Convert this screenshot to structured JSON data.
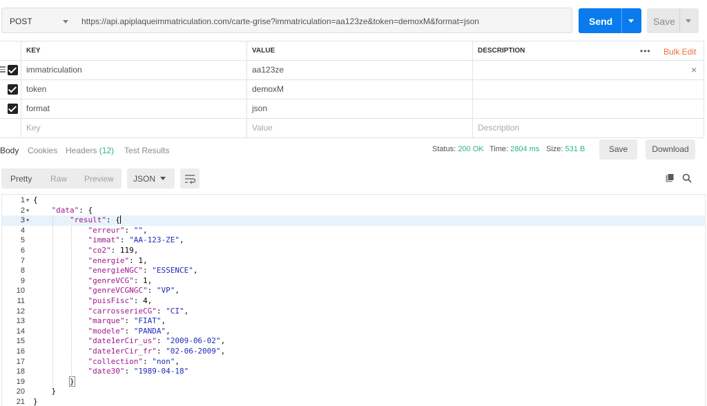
{
  "request": {
    "method": "POST",
    "url": "https://api.apiplaqueimmatriculation.com/carte-grise?immatriculation=aa123ze&token=demoxM&format=json",
    "send_label": "Send",
    "save_label": "Save"
  },
  "params": {
    "headers": {
      "key": "KEY",
      "value": "VALUE",
      "description": "DESCRIPTION",
      "dots": "•••",
      "bulk_edit": "Bulk Edit"
    },
    "rows": [
      {
        "key": "immatriculation",
        "value": "aa123ze",
        "description": "",
        "checked": true
      },
      {
        "key": "token",
        "value": "demoxM",
        "description": "",
        "checked": true
      },
      {
        "key": "format",
        "value": "json",
        "description": "",
        "checked": true
      }
    ],
    "placeholder": {
      "key": "Key",
      "value": "Value",
      "description": "Description"
    },
    "remove_icon": "×"
  },
  "response_tabs": {
    "body": "Body",
    "cookies": "Cookies",
    "headers": "Headers",
    "headers_count": "(12)",
    "test_results": "Test Results"
  },
  "status": {
    "status_label": "Status:",
    "status_value": "200 OK",
    "time_label": "Time:",
    "time_value": "2804 ms",
    "size_label": "Size:",
    "size_value": "531 B",
    "save_label": "Save",
    "download_label": "Download"
  },
  "view": {
    "pretty": "Pretty",
    "raw": "Raw",
    "preview": "Preview",
    "format": "JSON"
  },
  "colors": {
    "send": "#097bed",
    "success": "#26b47f",
    "bulk_edit": "#f26b3a",
    "json_key": "#a0178c",
    "json_string": "#1e2bb8"
  },
  "code_lines": [
    {
      "n": "1",
      "fold": true
    },
    {
      "n": "2",
      "fold": true
    },
    {
      "n": "3",
      "fold": true,
      "highlight": true
    },
    {
      "n": "4"
    },
    {
      "n": "5"
    },
    {
      "n": "6"
    },
    {
      "n": "7"
    },
    {
      "n": "8"
    },
    {
      "n": "9"
    },
    {
      "n": "10"
    },
    {
      "n": "11"
    },
    {
      "n": "12"
    },
    {
      "n": "13"
    },
    {
      "n": "14"
    },
    {
      "n": "15"
    },
    {
      "n": "16"
    },
    {
      "n": "17"
    },
    {
      "n": "18"
    },
    {
      "n": "19"
    },
    {
      "n": "20"
    },
    {
      "n": "21"
    }
  ],
  "json": {
    "open": "{",
    "close": "}",
    "data_key": "\"data\"",
    "result_key": "\"result\"",
    "fields": [
      {
        "key": "\"erreur\"",
        "value": "\"\"",
        "type": "s"
      },
      {
        "key": "\"immat\"",
        "value": "\"AA-123-ZE\"",
        "type": "s"
      },
      {
        "key": "\"co2\"",
        "value": "119",
        "type": "n"
      },
      {
        "key": "\"energie\"",
        "value": "1",
        "type": "n"
      },
      {
        "key": "\"energieNGC\"",
        "value": "\"ESSENCE\"",
        "type": "s"
      },
      {
        "key": "\"genreVCG\"",
        "value": "1",
        "type": "n"
      },
      {
        "key": "\"genreVCGNGC\"",
        "value": "\"VP\"",
        "type": "s"
      },
      {
        "key": "\"puisFisc\"",
        "value": "4",
        "type": "n"
      },
      {
        "key": "\"carrosserieCG\"",
        "value": "\"CI\"",
        "type": "s"
      },
      {
        "key": "\"marque\"",
        "value": "\"FIAT\"",
        "type": "s"
      },
      {
        "key": "\"modele\"",
        "value": "\"PANDA\"",
        "type": "s"
      },
      {
        "key": "\"date1erCir_us\"",
        "value": "\"2009-06-02\"",
        "type": "s"
      },
      {
        "key": "\"date1erCir_fr\"",
        "value": "\"02-06-2009\"",
        "type": "s"
      },
      {
        "key": "\"collection\"",
        "value": "\"non\"",
        "type": "s"
      },
      {
        "key": "\"date30\"",
        "value": "\"1989-04-18\"",
        "type": "s",
        "last": true
      }
    ]
  }
}
